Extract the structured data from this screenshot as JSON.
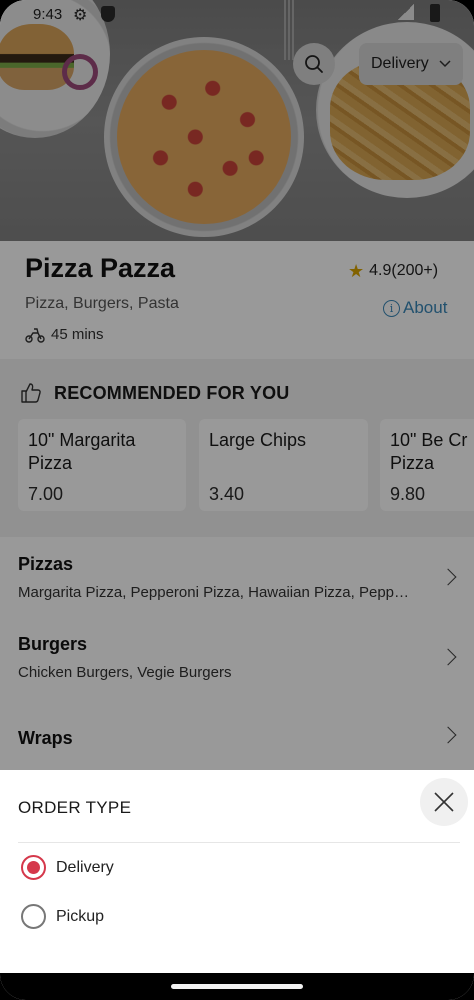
{
  "status": {
    "time": "9:43"
  },
  "header": {
    "delivery_label": "Delivery"
  },
  "restaurant": {
    "name": "Pizza Pazza",
    "cuisine": "Pizza, Burgers, Pasta",
    "delivery_time": "45 mins",
    "rating": "4.9(200+)",
    "about_label": "About"
  },
  "recommended": {
    "title": "RECOMMENDED FOR YOU",
    "items": [
      {
        "name": "10\" Margarita Pizza",
        "price": "7.00"
      },
      {
        "name": "Large Chips",
        "price": "3.40"
      },
      {
        "name": "10\" Be Cr Pizza",
        "price": "9.80"
      }
    ]
  },
  "categories": [
    {
      "name": "Pizzas",
      "items": "Margarita Pizza, Pepperoni Pizza, Hawaiian Pizza, Pepp…"
    },
    {
      "name": "Burgers",
      "items": "Chicken Burgers, Vegie Burgers"
    },
    {
      "name": "Wraps",
      "items": ""
    }
  ],
  "sheet": {
    "title": "ORDER TYPE",
    "options": [
      {
        "label": "Delivery",
        "selected": true
      },
      {
        "label": "Pickup",
        "selected": false
      }
    ],
    "accent": "#d5384b"
  }
}
